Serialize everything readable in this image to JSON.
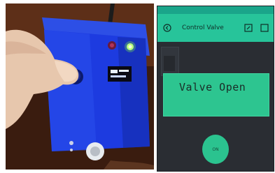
{
  "colors": {
    "accent": "#27c49a",
    "status_bar": "#1aa58a",
    "phone_background": "#2a2d33",
    "lcd_background": "#2dc590",
    "enclosure_blue": "#1f3ad6"
  },
  "photo": {
    "display_text": "-----"
  },
  "phone": {
    "status_bar_text": "",
    "app_bar": {
      "back_icon": "back-icon",
      "title": "Control Valve",
      "edit_icon": "edit-icon",
      "add_icon": "add-icon"
    },
    "terminal": {
      "label": "",
      "icon": "terminal-icon"
    },
    "lcd": {
      "line1": "Valve Open",
      "line2": ""
    },
    "button": {
      "label": "",
      "text": "ON"
    }
  }
}
